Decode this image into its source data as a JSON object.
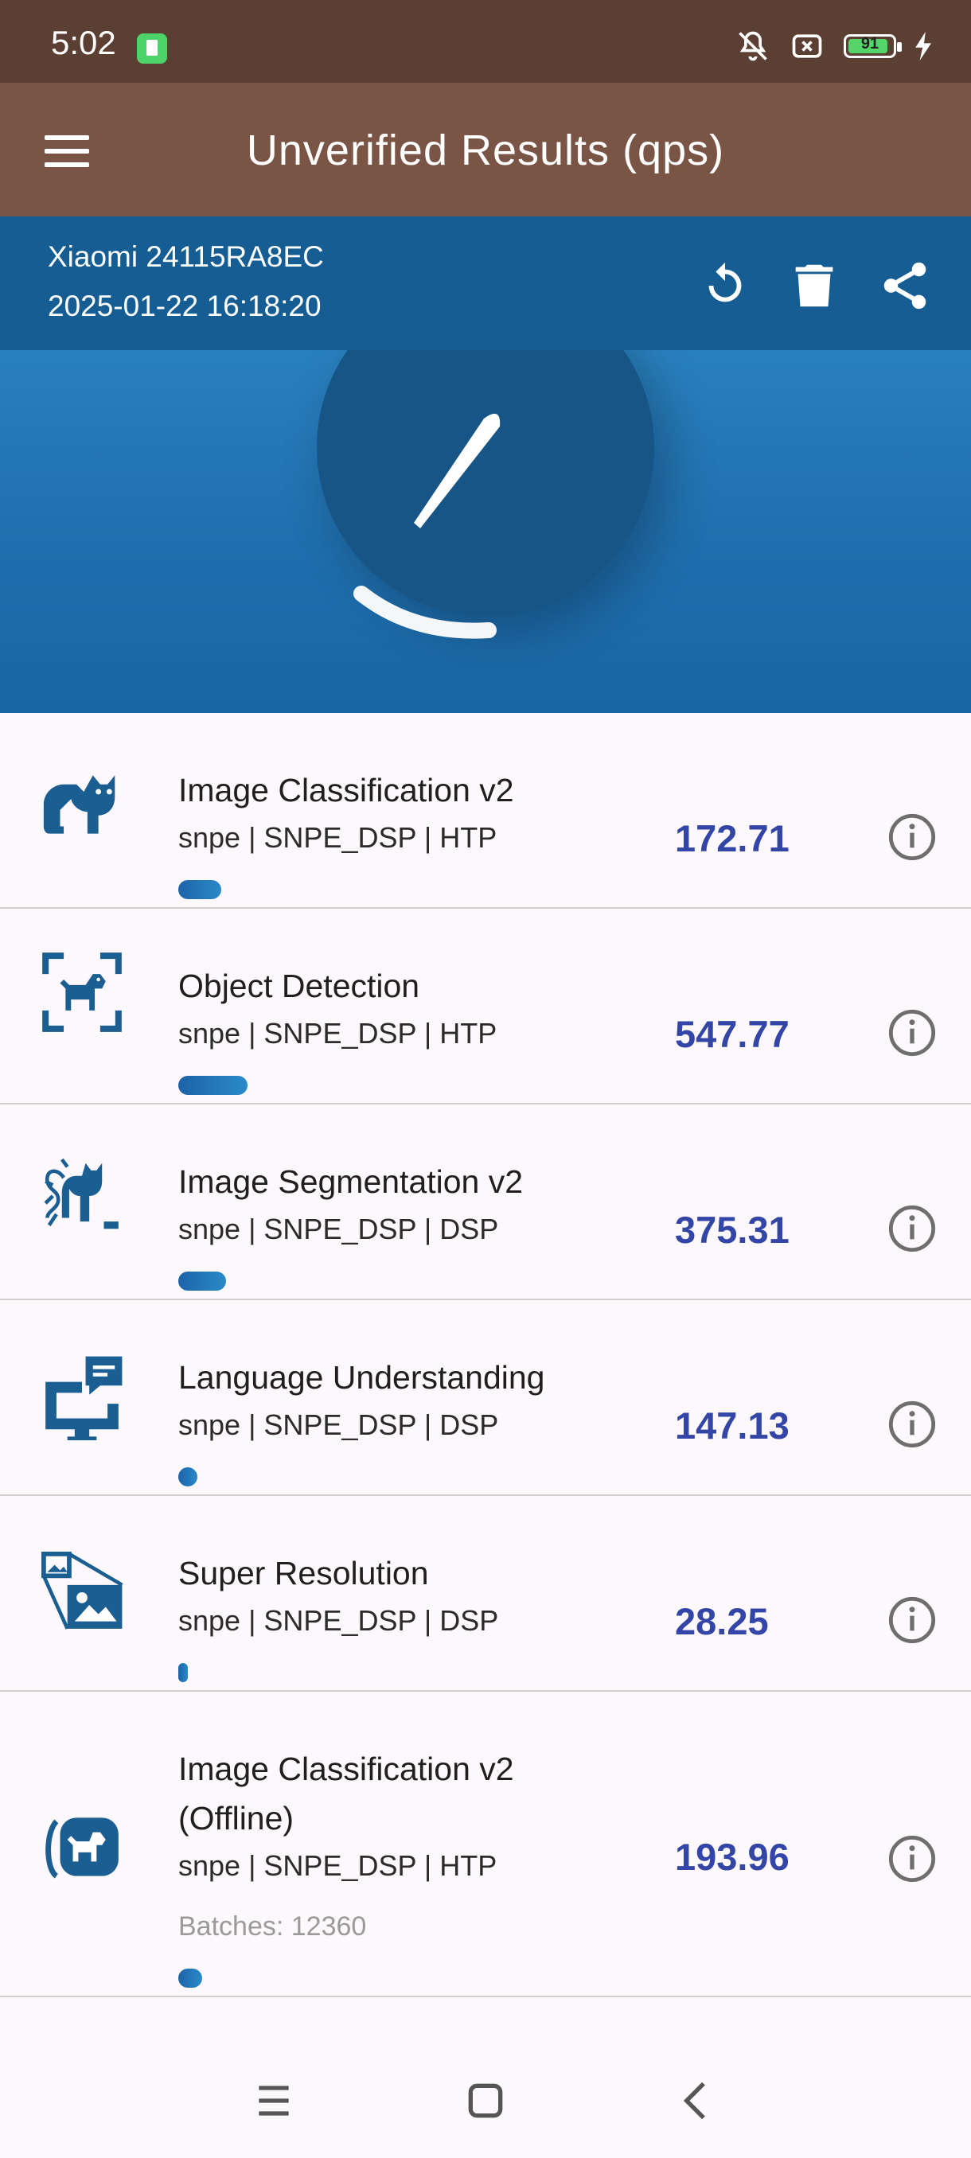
{
  "status_bar": {
    "time": "5:02",
    "battery_level": 91
  },
  "app_bar": {
    "title": "Unverified Results (qps)"
  },
  "device": {
    "name": "Xiaomi 24115RA8EC",
    "datetime": "2025-01-22 16:18:20"
  },
  "results": [
    {
      "name": "Image Classification v2",
      "backend": "snpe | SNPE_DSP | HTP",
      "value": "172.71",
      "icon": "cat-icon",
      "bar_fraction": 0.09
    },
    {
      "name": "Object Detection",
      "backend": "snpe | SNPE_DSP | HTP",
      "value": "547.77",
      "icon": "dog-detection-icon",
      "bar_fraction": 0.145
    },
    {
      "name": "Image Segmentation v2",
      "backend": "snpe | SNPE_DSP | DSP",
      "value": "375.31",
      "icon": "segmentation-icon",
      "bar_fraction": 0.1
    },
    {
      "name": "Language Understanding",
      "backend": "snpe | SNPE_DSP | DSP",
      "value": "147.13",
      "icon": "monitor-chat-icon",
      "bar_fraction": 0.04
    },
    {
      "name": "Super Resolution",
      "backend": "snpe | SNPE_DSP | DSP",
      "value": "28.25",
      "icon": "image-upscale-icon",
      "bar_fraction": 0.008
    },
    {
      "name": "Image Classification v2",
      "name_line2": "(Offline)",
      "backend": "snpe | SNPE_DSP | HTP",
      "value": "193.96",
      "batches": "Batches: 12360",
      "icon": "offline-dog-icon",
      "bar_fraction": 0.05
    }
  ],
  "colors": {
    "status_bar": "#5b3f33",
    "app_bar": "#7a5545",
    "device_bar": "#155d93",
    "value_text": "#3346a8"
  }
}
